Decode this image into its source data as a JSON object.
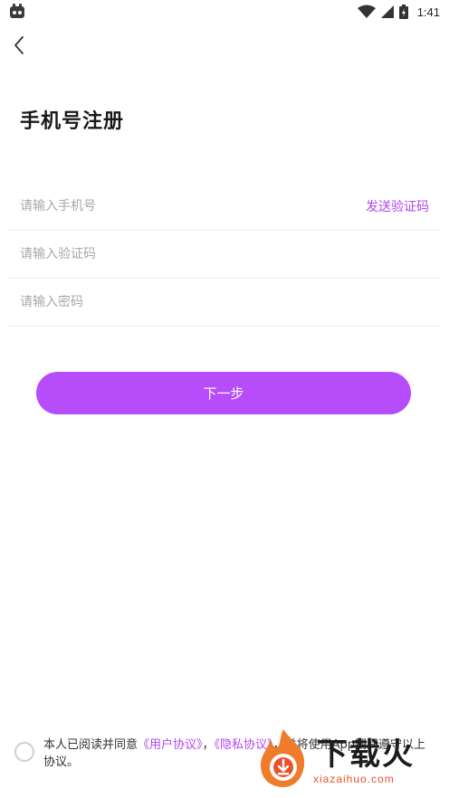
{
  "status_bar": {
    "time": "1:41",
    "icons": [
      "app-notification-icon",
      "wifi-icon",
      "cellular-signal-icon",
      "battery-icon"
    ]
  },
  "header": {
    "back_icon": "chevron-left-icon",
    "title": "手机号注册"
  },
  "form": {
    "phone_placeholder": "请输入手机号",
    "phone_value": "",
    "send_code_label": "发送验证码",
    "code_placeholder": "请输入验证码",
    "code_value": "",
    "password_placeholder": "请输入密码",
    "password_value": ""
  },
  "actions": {
    "next_label": "下一步"
  },
  "agreement": {
    "prefix": "本人已阅读并同意",
    "user_agreement": "《用户协议》",
    "separator": "，",
    "privacy_policy": "《隐私协议》",
    "suffix": "，并将使用App期间遵守以上协议。",
    "checked": false
  },
  "watermark": {
    "title": "下载火",
    "domain": "xiazaihuo.com"
  },
  "colors": {
    "accent": "#b74cfb",
    "link": "#b444f0",
    "divider": "#ececec",
    "placeholder": "#a8a8a8",
    "watermark_orange": "#e8512c"
  }
}
